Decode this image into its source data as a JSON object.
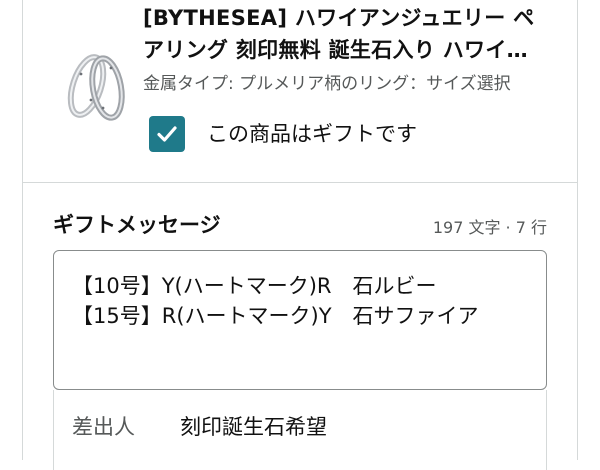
{
  "product": {
    "title": "[BYTHESEA] ハワイアンジュエリー ペアリング 刻印無料 誕生石入り ハワイアン 結婚指輪",
    "variant": "金属タイプ: プルメリア柄のリング：サイズ選択",
    "thumbnail_icon": "pair-rings-image"
  },
  "gift_option": {
    "checked": true,
    "label": "この商品はギフトです",
    "accent_color": "#1f7a8a"
  },
  "gift_message": {
    "heading": "ギフトメッセージ",
    "counter": "197 文字 · 7 行",
    "lines": [
      "【10号】Y(ハートマーク)R　石ルビー",
      "【15号】R(ハートマーク)Y　石サファイア"
    ]
  },
  "sender": {
    "label": "差出人",
    "value": "刻印誕生石希望"
  }
}
